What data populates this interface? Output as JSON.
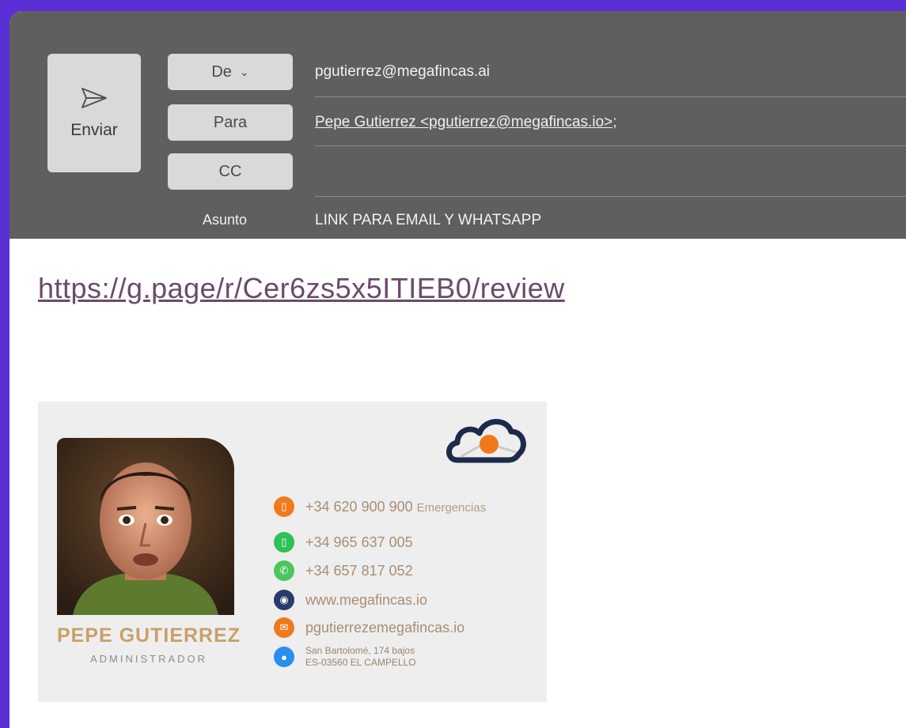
{
  "compose": {
    "send_label": "Enviar",
    "from_label": "De",
    "to_label": "Para",
    "cc_label": "CC",
    "subject_label": "Asunto",
    "from_value": "pgutierrez@megafincas.ai",
    "to_value": "Pepe Gutierrez <pgutierrez@megafincas.io>;",
    "cc_value": "",
    "subject_value": "LINK PARA EMAIL Y WHATSAPP"
  },
  "body": {
    "link": "https://g.page/r/Cer6zs5x5ITIEB0/review"
  },
  "signature": {
    "name": "PEPE GUTIERREZ",
    "role": "ADMINISTRADOR",
    "contacts": [
      {
        "icon": "mobile-icon",
        "color": "#f07a1a",
        "text": "+34 620 900 900",
        "extra": "Emergencias"
      },
      {
        "icon": "phone-icon",
        "color": "#2ec15a",
        "text": "+34 965 637 005"
      },
      {
        "icon": "whatsapp-icon",
        "color": "#4cc55e",
        "text": "+34 657 817 052"
      },
      {
        "icon": "globe-icon",
        "color": "#2a3a6a",
        "text": "www.megafincas.io"
      },
      {
        "icon": "mail-icon",
        "color": "#f07a1a",
        "text": "pgutierrezemegafincas.io"
      },
      {
        "icon": "location-icon",
        "color": "#2a8ef0",
        "line1": "San Bartolomé, 174 bajos",
        "line2": "ES-03560 EL CAMPELLO"
      }
    ],
    "accent_color": "#c8a06a"
  },
  "colors": {
    "frame": "#5b2fd6",
    "header": "#5f5f5f",
    "button": "#d9d9d9",
    "link": "#6a4b6a"
  }
}
